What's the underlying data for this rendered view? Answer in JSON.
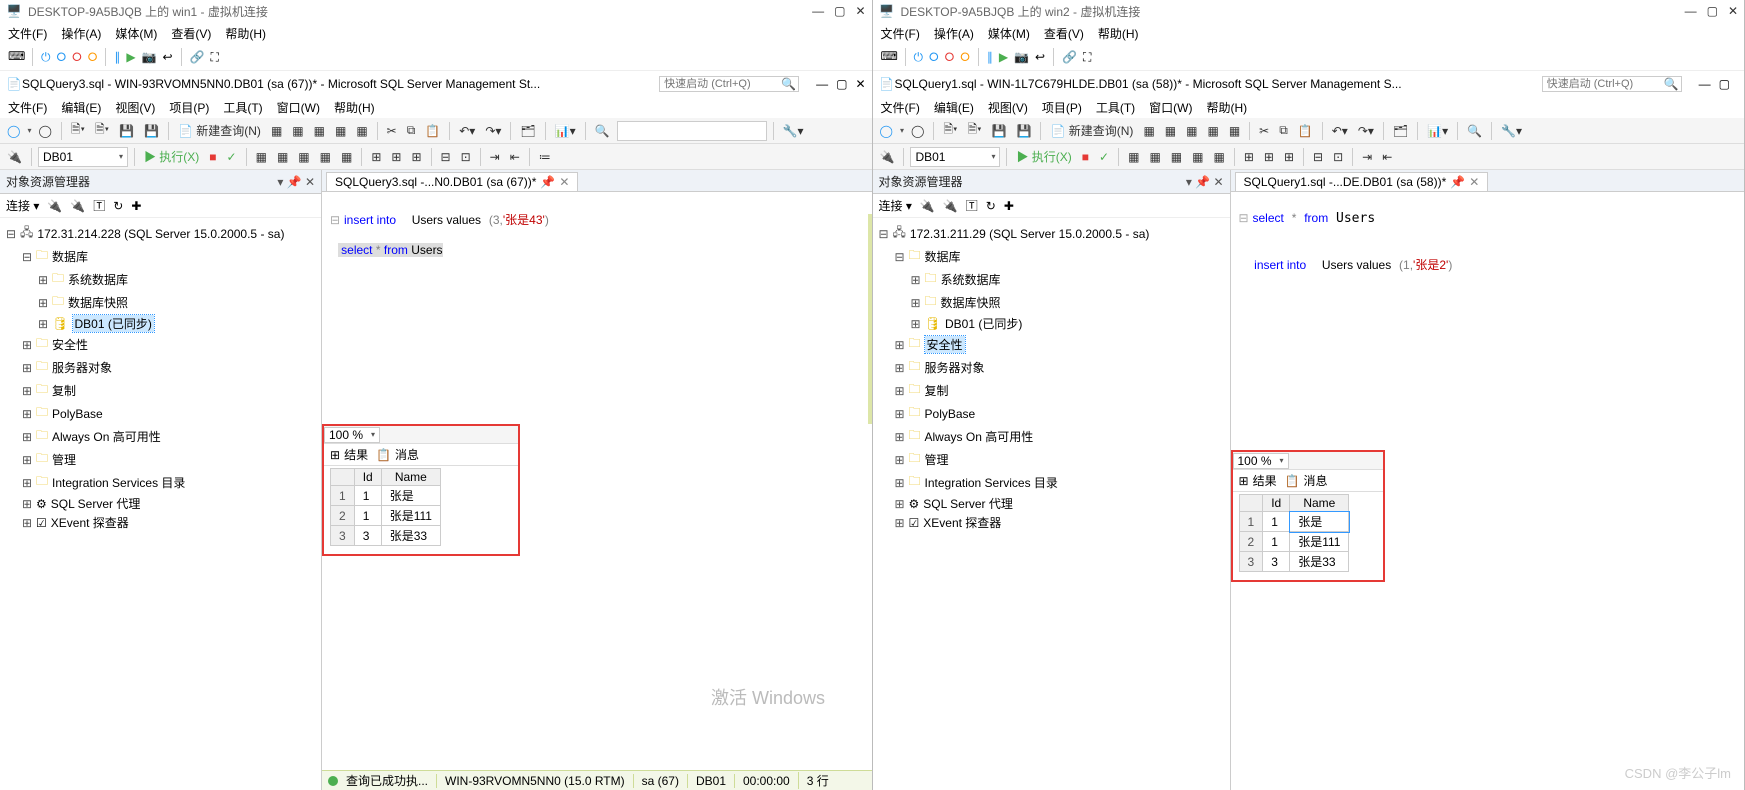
{
  "left": {
    "vm_title": "DESKTOP-9A5BJQB 上的 win1 - 虚拟机连接",
    "vm_menu": [
      "文件(F)",
      "操作(A)",
      "媒体(M)",
      "查看(V)",
      "帮助(H)"
    ],
    "ssms_title": "SQLQuery3.sql - WIN-93RVOMN5NN0.DB01 (sa (67))* - Microsoft SQL Server Management St...",
    "quick_placeholder": "快速启动 (Ctrl+Q)",
    "ssms_menu": [
      "文件(F)",
      "编辑(E)",
      "视图(V)",
      "项目(P)",
      "工具(T)",
      "窗口(W)",
      "帮助(H)"
    ],
    "new_query": "新建查询(N)",
    "db_combo": "DB01",
    "execute": "执行(X)",
    "explorer_title": "对象资源管理器",
    "connect_label": "连接 ▾",
    "server_node": "172.31.214.228 (SQL Server 15.0.2000.5 - sa)",
    "dbs_node": "数据库",
    "sys_db": "系统数据库",
    "snap": "数据库快照",
    "db01": "DB01 (已同步)",
    "nodes": [
      "安全性",
      "服务器对象",
      "复制",
      "PolyBase",
      "Always On 高可用性",
      "管理",
      "Integration Services 目录",
      "SQL Server 代理",
      "XEvent 探查器"
    ],
    "tab_name": "SQLQuery3.sql -...N0.DB01 (sa (67))*",
    "sql_line1_pre": "insert into",
    "sql_line1_mid": "Users values",
    "sql_line1_num": "(3,",
    "sql_line1_str": "'张是43'",
    "sql_line1_end": ")",
    "sql_line2": "select * from Users",
    "zoom": "100 %",
    "res_tab_result": "结果",
    "res_tab_msg": "消息",
    "cols": {
      "id": "Id",
      "name": "Name"
    },
    "rows": [
      {
        "n": "1",
        "id": "1",
        "name": "张是"
      },
      {
        "n": "2",
        "id": "1",
        "name": "张是111"
      },
      {
        "n": "3",
        "id": "3",
        "name": "张是33"
      }
    ],
    "status_ok": "查询已成功执...",
    "status_server": "WIN-93RVOMN5NN0 (15.0 RTM)",
    "status_user": "sa (67)",
    "status_db": "DB01",
    "status_time": "00:00:00",
    "status_rows": "3 行"
  },
  "right": {
    "vm_title": "DESKTOP-9A5BJQB 上的 win2 - 虚拟机连接",
    "vm_menu": [
      "文件(F)",
      "操作(A)",
      "媒体(M)",
      "查看(V)",
      "帮助(H)"
    ],
    "ssms_title": "SQLQuery1.sql - WIN-1L7C679HLDE.DB01 (sa (58))* - Microsoft SQL Server Management S...",
    "quick_placeholder": "快速启动 (Ctrl+Q)",
    "ssms_menu": [
      "文件(F)",
      "编辑(E)",
      "视图(V)",
      "项目(P)",
      "工具(T)",
      "窗口(W)",
      "帮助(H)"
    ],
    "new_query": "新建查询(N)",
    "db_combo": "DB01",
    "execute": "执行(X)",
    "explorer_title": "对象资源管理器",
    "connect_label": "连接 ▾",
    "server_node": "172.31.211.29 (SQL Server 15.0.2000.5 - sa)",
    "dbs_node": "数据库",
    "sys_db": "系统数据库",
    "snap": "数据库快照",
    "db01": "DB01 (已同步)",
    "sel_node": "安全性",
    "nodes": [
      "服务器对象",
      "复制",
      "PolyBase",
      "Always On 高可用性",
      "管理",
      "Integration Services 目录",
      "SQL Server 代理",
      "XEvent 探查器"
    ],
    "tab_name": "SQLQuery1.sql -...DE.DB01 (sa (58))*",
    "sql_line1": "select * from Users",
    "sql_line3_pre": "insert into",
    "sql_line3_mid": "Users values",
    "sql_line3_num": "(1,",
    "sql_line3_str": "'张是2'",
    "sql_line3_end": ")",
    "zoom": "100 %",
    "res_tab_result": "结果",
    "res_tab_msg": "消息",
    "cols": {
      "id": "Id",
      "name": "Name"
    },
    "rows": [
      {
        "n": "1",
        "id": "1",
        "name": "张是"
      },
      {
        "n": "2",
        "id": "1",
        "name": "张是111"
      },
      {
        "n": "3",
        "id": "3",
        "name": "张是33"
      }
    ]
  },
  "activation": "激活 Windows",
  "watermark": "CSDN @李公子lm"
}
